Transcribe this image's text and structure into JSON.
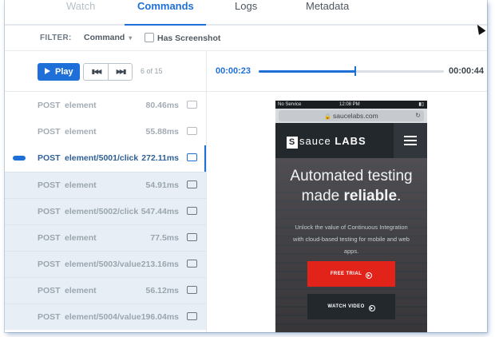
{
  "tabs": [
    {
      "label": "Watch",
      "active": false
    },
    {
      "label": "Commands",
      "active": true
    },
    {
      "label": "Logs",
      "active": false
    },
    {
      "label": "Metadata",
      "active": false
    }
  ],
  "filter": {
    "label": "FILTER:",
    "select_value": "Command",
    "checkbox_label": "Has Screenshot",
    "checkbox_checked": false
  },
  "player": {
    "play_label": "Play",
    "counter": "6 of 15",
    "current_time": "00:00:23",
    "total_time": "00:00:44",
    "progress_fraction": 0.523
  },
  "commands": [
    {
      "method": "POST",
      "path": "element",
      "duration": "80.46ms",
      "state": "done"
    },
    {
      "method": "POST",
      "path": "element",
      "duration": "55.88ms",
      "state": "done"
    },
    {
      "method": "POST",
      "path": "element/5001/click",
      "duration": "272.11ms",
      "state": "current"
    },
    {
      "method": "POST",
      "path": "element",
      "duration": "54.91ms",
      "state": "pending"
    },
    {
      "method": "POST",
      "path": "element/5002/click",
      "duration": "547.44ms",
      "state": "pending"
    },
    {
      "method": "POST",
      "path": "element",
      "duration": "77.5ms",
      "state": "pending"
    },
    {
      "method": "POST",
      "path": "element/5003/value",
      "duration": "213.16ms",
      "state": "pending"
    },
    {
      "method": "POST",
      "path": "element",
      "duration": "56.12ms",
      "state": "pending"
    },
    {
      "method": "POST",
      "path": "element/5004/value",
      "duration": "196.04ms",
      "state": "pending"
    }
  ],
  "preview": {
    "status_left": "No Service",
    "status_time": "12:08 PM",
    "url": "saucelabs.com",
    "logo_letter": "S",
    "logo_text": "sauce",
    "logo_bold": "LABS",
    "headline_line1": "Automated testing",
    "headline_line2_prefix": "made",
    "headline_line2_bold": "reliable",
    "headline_line2_suffix": ".",
    "subtext": "Unlock the value of Continuous Integration with cloud-based testing for mobile and web apps.",
    "cta_trial": "FREE TRIAL",
    "cta_video": "WATCH VIDEO"
  },
  "colors": {
    "accent": "#1f6fd8",
    "pending_row": "#e7eef6",
    "cta_red": "#e2231a"
  }
}
